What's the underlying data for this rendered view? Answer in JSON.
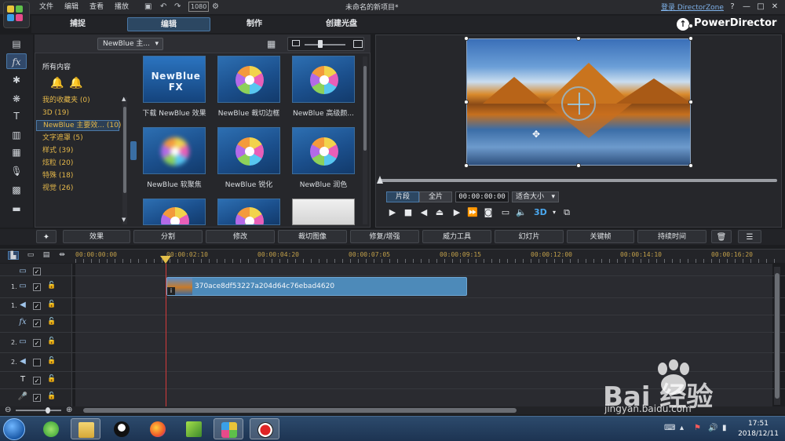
{
  "menu": {
    "file": "文件",
    "edit": "编辑",
    "view": "查看",
    "play": "播放"
  },
  "toolbar": {
    "resolution": "1080",
    "gear": "⚙"
  },
  "window": {
    "title": "未命名的新项目*",
    "login": "登录 DirectorZone",
    "help": "?",
    "minimize": "—",
    "maximize": "□",
    "close": "✕"
  },
  "modes": {
    "capture": "捕捉",
    "edit": "编辑",
    "produce": "制作",
    "disc": "创建光盘"
  },
  "brand": "PowerDirector",
  "library": {
    "dropdown": "NewBlue 主...",
    "tree_header": "所有内容",
    "tree": [
      {
        "label": "我的收藏夹  (0)"
      },
      {
        "label": "3D  (19)"
      },
      {
        "label": "NewBlue 主要效...  (10)"
      },
      {
        "label": "文字遮罩  (5)"
      },
      {
        "label": "样式  (39)"
      },
      {
        "label": "炫粒  (20)"
      },
      {
        "label": "特殊  (18)"
      },
      {
        "label": "视觉  (26)"
      }
    ],
    "items": [
      {
        "label": "下载 NewBlue 效果",
        "logo": "NewBlue FX"
      },
      {
        "label": "NewBlue 裁切边框"
      },
      {
        "label": "NewBlue 高级颜..."
      },
      {
        "label": "NewBlue 软聚焦"
      },
      {
        "label": "NewBlue 锐化"
      },
      {
        "label": "NewBlue 润色"
      }
    ]
  },
  "preview": {
    "tab_clip": "片段",
    "tab_full": "全片",
    "timecode": "00:00:00:00",
    "fit": "适合大小",
    "three_d": "3D"
  },
  "functions": [
    "效果",
    "分割",
    "修改",
    "裁切图像",
    "修复/增强",
    "威力工具",
    "幻灯片",
    "关键帧",
    "持续时间"
  ],
  "timeline": {
    "ruler": [
      "00:00:00:00",
      "00:00:02:10",
      "00:00:04:20",
      "00:00:07:05",
      "00:00:09:15",
      "00:00:12:00",
      "00:00:14:10",
      "00:00:16:20"
    ],
    "tracks": [
      {
        "label": "",
        "icon": "▭"
      },
      {
        "label": "1.",
        "icon": "▭"
      },
      {
        "label": "1.",
        "icon": "◀"
      },
      {
        "label": "",
        "icon": "fx"
      },
      {
        "label": "2.",
        "icon": "▭"
      },
      {
        "label": "2.",
        "icon": "◀"
      },
      {
        "label": "",
        "icon": "T"
      },
      {
        "label": "",
        "icon": "🎤"
      }
    ],
    "clip_name": "370ace8df53227a204d64c76ebad4620"
  },
  "taskbar": {
    "time": "17:51",
    "date": "2018/12/11"
  },
  "watermark": {
    "brand": "Bai  经验",
    "url": "jingyan.baidu.com"
  }
}
